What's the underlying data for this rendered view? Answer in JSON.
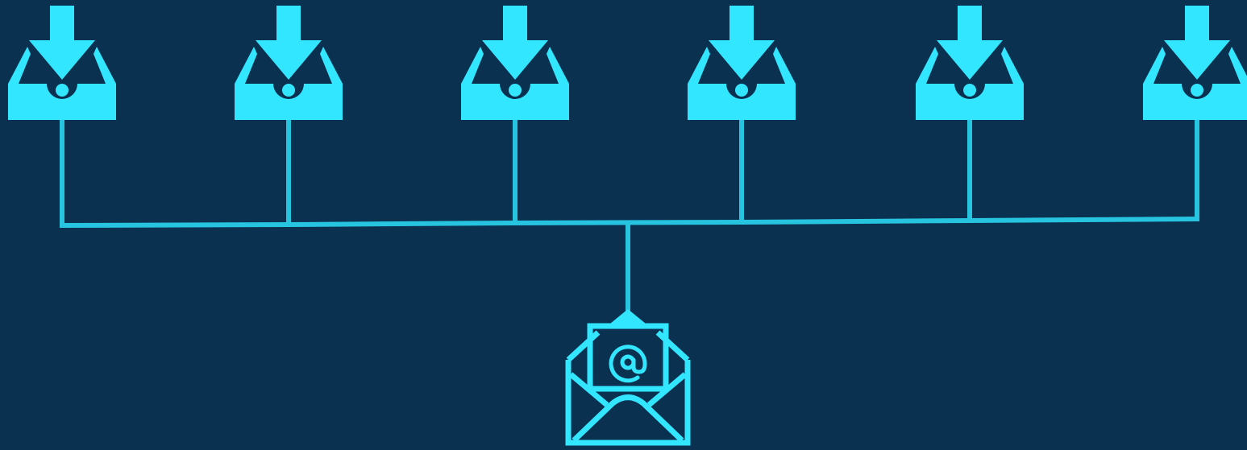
{
  "colors": {
    "background": "#0a3150",
    "icon": "#33e6ff",
    "connector": "#27c4e0"
  },
  "diagram": {
    "type": "tree",
    "root": {
      "name": "email-envelope",
      "icon": "open-envelope-with-at-sign-icon"
    },
    "leaves": [
      {
        "name": "inbox-1",
        "icon": "inbox-download-icon"
      },
      {
        "name": "inbox-2",
        "icon": "inbox-download-icon"
      },
      {
        "name": "inbox-3",
        "icon": "inbox-download-icon"
      },
      {
        "name": "inbox-4",
        "icon": "inbox-download-icon"
      },
      {
        "name": "inbox-5",
        "icon": "inbox-download-icon"
      },
      {
        "name": "inbox-6",
        "icon": "inbox-download-icon"
      }
    ],
    "edges": [
      {
        "from": "email-envelope",
        "to": "inbox-1"
      },
      {
        "from": "email-envelope",
        "to": "inbox-2"
      },
      {
        "from": "email-envelope",
        "to": "inbox-3"
      },
      {
        "from": "email-envelope",
        "to": "inbox-4"
      },
      {
        "from": "email-envelope",
        "to": "inbox-5"
      },
      {
        "from": "email-envelope",
        "to": "inbox-6"
      }
    ]
  }
}
